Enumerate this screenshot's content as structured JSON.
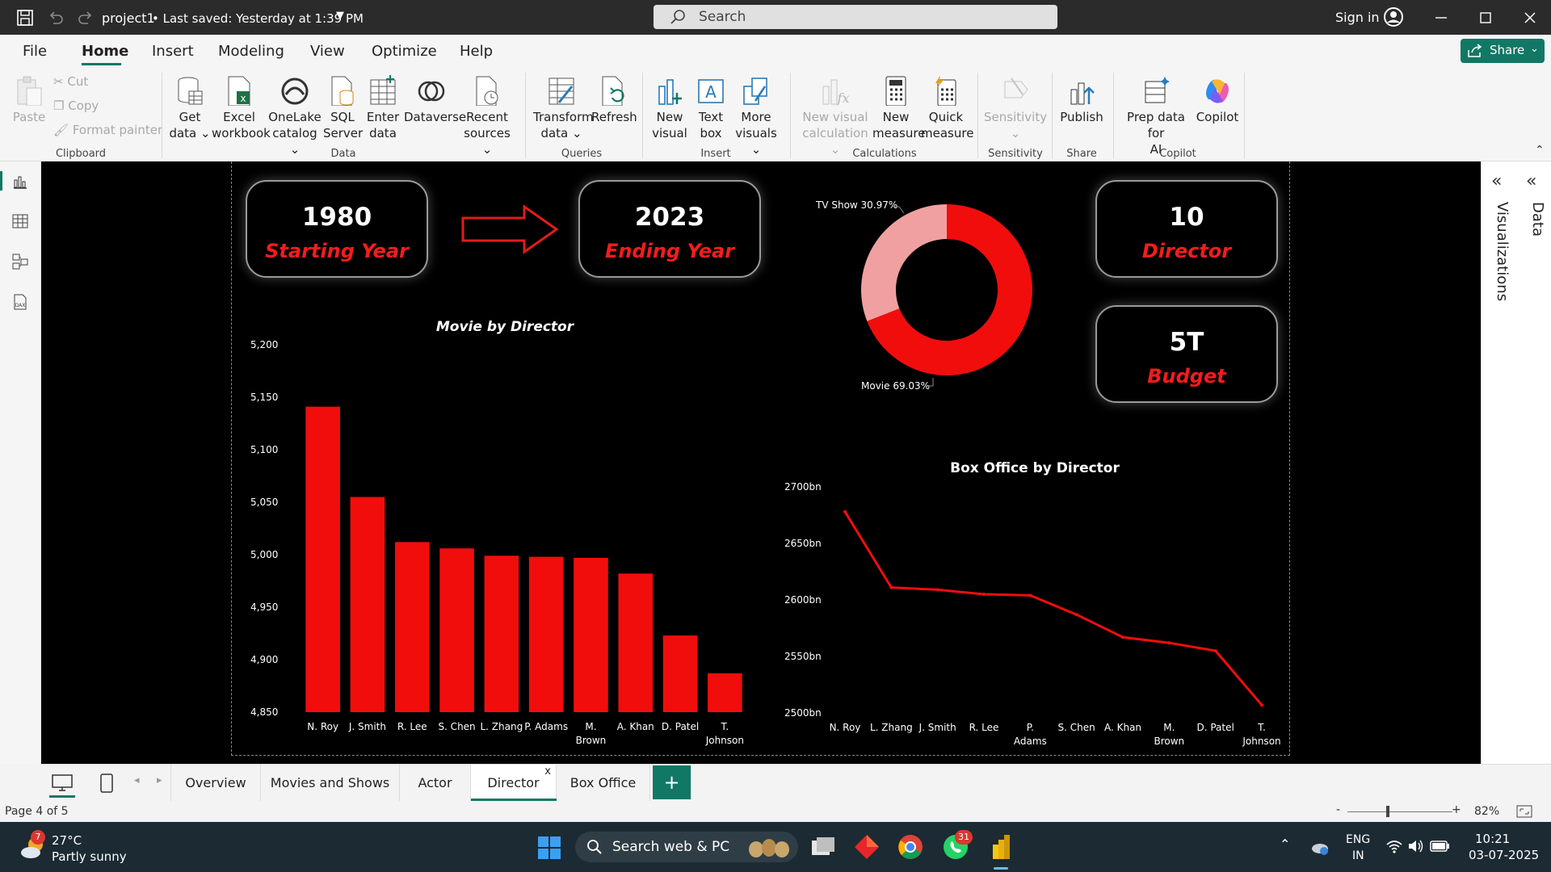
{
  "titlebar": {
    "title": "project1",
    "saved": "• Last saved: Yesterday at 1:39 PM",
    "search_placeholder": "Search",
    "signin": "Sign in"
  },
  "menu": {
    "items": [
      "File",
      "Home",
      "Insert",
      "Modeling",
      "View",
      "Optimize",
      "Help"
    ],
    "active": "Home",
    "share": "Share"
  },
  "ribbon": {
    "paste": "Paste",
    "cut": "Cut",
    "copy": "Copy",
    "format_painter": "Format painter",
    "get_data": [
      "Get",
      "data ⌄"
    ],
    "excel": [
      "Excel",
      "workbook"
    ],
    "onelake": [
      "OneLake",
      "catalog ⌄"
    ],
    "sql": [
      "SQL",
      "Server"
    ],
    "enter": [
      "Enter",
      "data"
    ],
    "dataverse": [
      "Dataverse"
    ],
    "recent": [
      "Recent",
      "sources ⌄"
    ],
    "transform": [
      "Transform",
      "data ⌄"
    ],
    "refresh": [
      "Refresh"
    ],
    "new_visual": [
      "New",
      "visual"
    ],
    "text_box": [
      "Text",
      "box"
    ],
    "more_visuals": [
      "More",
      "visuals ⌄"
    ],
    "new_visual_calc": [
      "New visual",
      "calculation ⌄"
    ],
    "new_measure": [
      "New",
      "measure"
    ],
    "quick_measure": [
      "Quick",
      "measure"
    ],
    "sensitivity": [
      "Sensitivity",
      "⌄"
    ],
    "publish": [
      "Publish"
    ],
    "prep_ai": [
      "Prep data for",
      "AI"
    ],
    "copilot": [
      "Copilot"
    ],
    "groups": [
      "Clipboard",
      "Data",
      "Queries",
      "Insert",
      "Calculations",
      "Sensitivity",
      "Share",
      "Copilot"
    ]
  },
  "cards": {
    "start": {
      "value": "1980",
      "label": "Starting Year"
    },
    "end": {
      "value": "2023",
      "label": "Ending Year"
    },
    "director": {
      "value": "10",
      "label": "Director"
    },
    "budget": {
      "value": "5T",
      "label": "Budget"
    }
  },
  "chart_data": [
    {
      "type": "bar",
      "title": "Movie by Director",
      "categories": [
        "N. Roy",
        "J. Smith",
        "R. Lee",
        "S. Chen",
        "L. Zhang",
        "P. Adams",
        "M. Brown",
        "A. Khan",
        "D. Patel",
        "T. Johnson"
      ],
      "category_lines": [
        [
          "N. Roy"
        ],
        [
          "J. Smith"
        ],
        [
          "R. Lee"
        ],
        [
          "S. Chen"
        ],
        [
          "L. Zhang"
        ],
        [
          "P. Adams"
        ],
        [
          "M.",
          "Brown"
        ],
        [
          "A. Khan"
        ],
        [
          "D. Patel"
        ],
        [
          "T.",
          "Johnson"
        ]
      ],
      "values": [
        5141,
        5055,
        5012,
        5006,
        4999,
        4998,
        4997,
        4982,
        4923,
        4887
      ],
      "ylim": [
        4850,
        5200
      ],
      "yticks": [
        "5,200",
        "5,150",
        "5,100",
        "5,050",
        "5,000",
        "4,950",
        "4,900",
        "4,850"
      ],
      "color": "#f20d0d"
    },
    {
      "type": "pie",
      "slices": [
        {
          "label": "TV Show 30.97%",
          "value": 30.97,
          "color": "#f0a0a0"
        },
        {
          "label": "Movie 69.03%",
          "value": 69.03,
          "color": "#f20d0d"
        }
      ]
    },
    {
      "type": "line",
      "title": "Box Office by Director",
      "categories": [
        "N. Roy",
        "L. Zhang",
        "J. Smith",
        "R. Lee",
        "P. Adams",
        "S. Chen",
        "A. Khan",
        "M. Brown",
        "D. Patel",
        "T. Johnson"
      ],
      "category_lines": [
        [
          "N. Roy"
        ],
        [
          "L. Zhang"
        ],
        [
          "J. Smith"
        ],
        [
          "R. Lee"
        ],
        [
          "P.",
          "Adams"
        ],
        [
          "S. Chen"
        ],
        [
          "A. Khan"
        ],
        [
          "M.",
          "Brown"
        ],
        [
          "D. Patel"
        ],
        [
          "T.",
          "Johnson"
        ]
      ],
      "values": [
        2678,
        2611,
        2609,
        2605,
        2604,
        2587,
        2567,
        2562,
        2555,
        2507
      ],
      "ylim": [
        2500,
        2700
      ],
      "yticks": [
        "2700bn",
        "2650bn",
        "2600bn",
        "2550bn",
        "2500bn"
      ],
      "color": "#f20d0d"
    }
  ],
  "right_panes": {
    "visualizations": "Visualizations",
    "data": "Data"
  },
  "tabs": {
    "items": [
      "Overview",
      "Movies and Shows",
      "Actor",
      "Director",
      "Box Office"
    ],
    "active": "Director",
    "close": "x",
    "add": "+"
  },
  "status": {
    "page": "Page 4 of 5",
    "zoom": "82%",
    "zoom_minus": "-",
    "zoom_plus": "+"
  },
  "taskbar": {
    "weather_temp": "27°C",
    "weather_desc": "Partly sunny",
    "weather_badge": "7",
    "search": "Search web & PC",
    "whatsapp_badge": "31",
    "lang1": "ENG",
    "lang2": "IN",
    "time": "10:21",
    "date": "03-07-2025"
  }
}
